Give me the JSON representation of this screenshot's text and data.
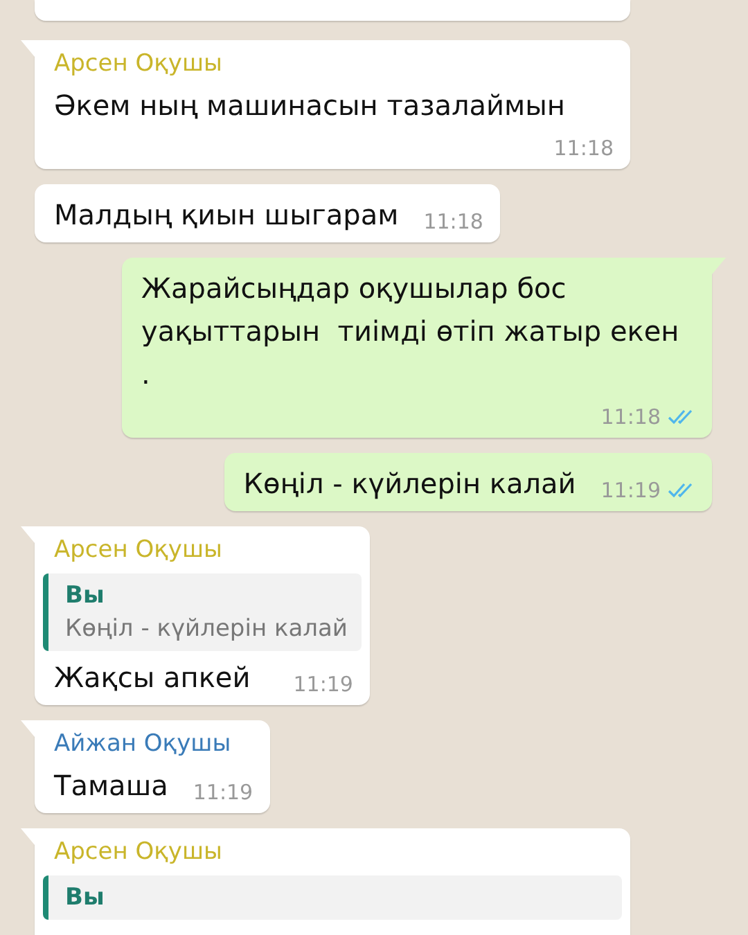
{
  "messages": [
    {
      "kind": "incoming",
      "cut": true,
      "tail": false
    },
    {
      "kind": "incoming",
      "tail": true,
      "sender": "Арсен Оқушы",
      "color": "#c9b52a",
      "text": "Әкем ның машинасын тазалаймын",
      "time": "11:18"
    },
    {
      "kind": "incoming",
      "tail": false,
      "text": "Малдың қиын шыгарам",
      "time": "11:18"
    },
    {
      "kind": "outgoing",
      "tail": true,
      "text": "Жарайсыңдар оқушылар бос уақыттарын  тиімді өтіп жатыр екен .",
      "time": "11:18",
      "read": true
    },
    {
      "kind": "outgoing",
      "tail": false,
      "text": "Көңіл - күйлерін калай",
      "time": "11:19",
      "read": true
    },
    {
      "kind": "incoming",
      "tail": true,
      "sender": "Арсен Оқушы",
      "color": "#c9b52a",
      "quote": {
        "author": "Вы",
        "text": "Көңіл - күйлерін калай"
      },
      "text": "Жақсы апкей",
      "time": "11:19"
    },
    {
      "kind": "incoming",
      "tail": true,
      "sender": "Айжан Оқушы",
      "color": "#3a7bb8",
      "text": "Тамаша",
      "time": "11:19"
    },
    {
      "kind": "incoming",
      "tail": true,
      "sender": "Арсен Оқушы",
      "color": "#c9b52a",
      "quote": {
        "author": "Вы"
      },
      "wide": true
    }
  ]
}
